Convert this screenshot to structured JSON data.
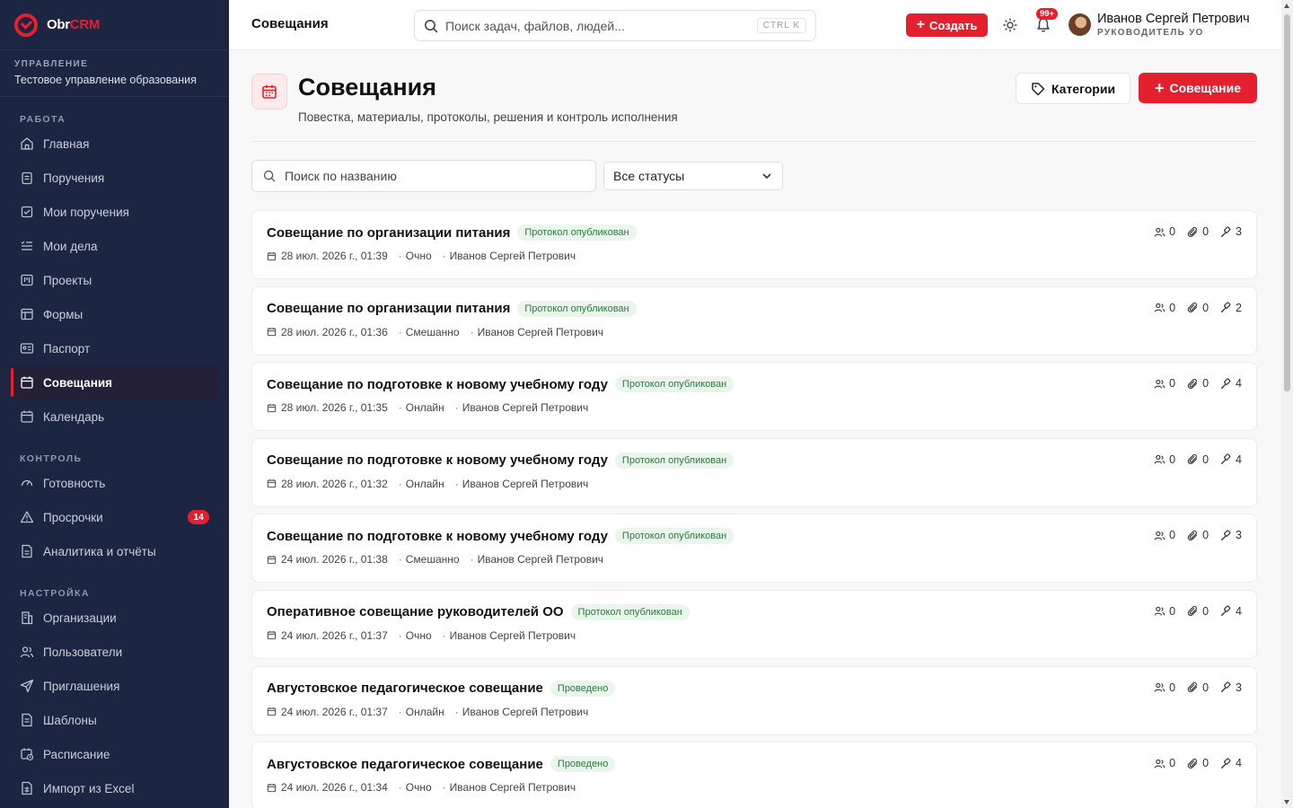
{
  "brand": {
    "name_main": "Obr",
    "name_accent": "CRM"
  },
  "org": {
    "label": "УПРАВЛЕНИЕ",
    "name": "Тестовое управление образования"
  },
  "sidebar": {
    "sections": [
      {
        "title": "РАБОТА",
        "items": [
          {
            "label": "Главная",
            "icon": "home-icon"
          },
          {
            "label": "Поручения",
            "icon": "clipboard-icon"
          },
          {
            "label": "Мои поручения",
            "icon": "checkbox-icon"
          },
          {
            "label": "Мои дела",
            "icon": "list-check-icon"
          },
          {
            "label": "Проекты",
            "icon": "kanban-icon"
          },
          {
            "label": "Формы",
            "icon": "table-icon"
          },
          {
            "label": "Паспорт",
            "icon": "id-card-icon"
          },
          {
            "label": "Совещания",
            "icon": "calendar-icon",
            "active": true
          },
          {
            "label": "Календарь",
            "icon": "calendar-icon"
          }
        ]
      },
      {
        "title": "КОНТРОЛЬ",
        "items": [
          {
            "label": "Готовность",
            "icon": "gauge-icon"
          },
          {
            "label": "Просрочки",
            "icon": "warning-icon",
            "badge": "14"
          },
          {
            "label": "Аналитика и отчёты",
            "icon": "report-icon"
          }
        ]
      },
      {
        "title": "НАСТРОЙКА",
        "items": [
          {
            "label": "Организации",
            "icon": "building-icon"
          },
          {
            "label": "Пользователи",
            "icon": "users-icon"
          },
          {
            "label": "Приглашения",
            "icon": "send-icon"
          },
          {
            "label": "Шаблоны",
            "icon": "document-icon"
          },
          {
            "label": "Расписание",
            "icon": "calendar-clock-icon"
          },
          {
            "label": "Импорт из Excel",
            "icon": "spreadsheet-icon"
          }
        ]
      }
    ]
  },
  "topbar": {
    "title": "Совещания",
    "search_placeholder": "Поиск задач, файлов, людей...",
    "shortcut": "CTRL K",
    "create_label": "Создать",
    "notifications_badge": "99+",
    "user_name": "Иванов Сергей Петрович",
    "user_role": "РУКОВОДИТЕЛЬ УО"
  },
  "page": {
    "title": "Совещания",
    "subtitle": "Повестка, материалы, протоколы, решения и контроль исполнения",
    "categories_label": "Категории",
    "new_meeting_label": "Совещание",
    "search_placeholder": "Поиск по названию",
    "status_filter": "Все статусы"
  },
  "colors": {
    "accent": "#e5202e",
    "sidebar_bg": "#1c2541",
    "badge_green": "#2c7a3f"
  },
  "meetings": [
    {
      "title": "Совещание по организации питания",
      "status": "Протокол опубликован",
      "date": "28 июл. 2026 г., 01:39",
      "format": "Очно",
      "author": "Иванов Сергей Петрович",
      "participants": "0",
      "files": "0",
      "decisions": "3"
    },
    {
      "title": "Совещание по организации питания",
      "status": "Протокол опубликован",
      "date": "28 июл. 2026 г., 01:36",
      "format": "Смешанно",
      "author": "Иванов Сергей Петрович",
      "participants": "0",
      "files": "0",
      "decisions": "2"
    },
    {
      "title": "Совещание по подготовке к новому учебному году",
      "status": "Протокол опубликован",
      "date": "28 июл. 2026 г., 01:35",
      "format": "Онлайн",
      "author": "Иванов Сергей Петрович",
      "participants": "0",
      "files": "0",
      "decisions": "4"
    },
    {
      "title": "Совещание по подготовке к новому учебному году",
      "status": "Протокол опубликован",
      "date": "28 июл. 2026 г., 01:32",
      "format": "Онлайн",
      "author": "Иванов Сергей Петрович",
      "participants": "0",
      "files": "0",
      "decisions": "4"
    },
    {
      "title": "Совещание по подготовке к новому учебному году",
      "status": "Протокол опубликован",
      "date": "24 июл. 2026 г., 01:38",
      "format": "Смешанно",
      "author": "Иванов Сергей Петрович",
      "participants": "0",
      "files": "0",
      "decisions": "3"
    },
    {
      "title": "Оперативное совещание руководителей ОО",
      "status": "Протокол опубликован",
      "date": "24 июл. 2026 г., 01:37",
      "format": "Очно",
      "author": "Иванов Сергей Петрович",
      "participants": "0",
      "files": "0",
      "decisions": "4"
    },
    {
      "title": "Августовское педагогическое совещание",
      "status": "Проведено",
      "date": "24 июл. 2026 г., 01:37",
      "format": "Онлайн",
      "author": "Иванов Сергей Петрович",
      "participants": "0",
      "files": "0",
      "decisions": "3"
    },
    {
      "title": "Августовское педагогическое совещание",
      "status": "Проведено",
      "date": "24 июл. 2026 г., 01:34",
      "format": "Очно",
      "author": "Иванов Сергей Петрович",
      "participants": "0",
      "files": "0",
      "decisions": "4"
    }
  ]
}
